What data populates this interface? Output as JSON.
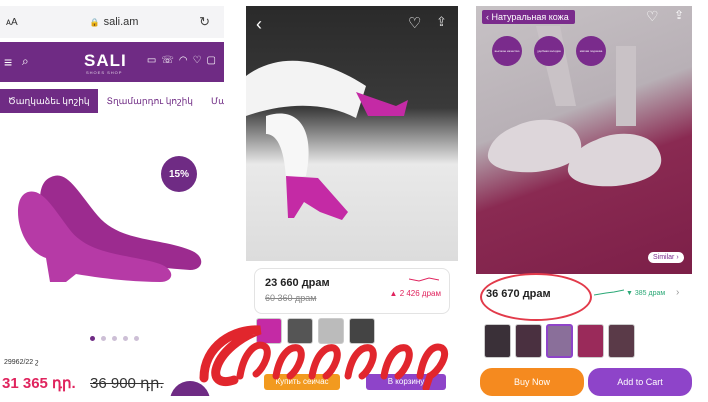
{
  "panel1": {
    "aa": "ᴀA",
    "url": "sali.am",
    "logo": "SALI",
    "logo_sub": "SHOES SHOP",
    "categories": [
      "Ծաղկաձեւ կոշիկ",
      "Տղամարդու կոշիկ",
      "Մանկակ"
    ],
    "discount": "15%",
    "sku": "29962/22 շ",
    "price_now": "31 365 դր.",
    "price_old": "36 900 դր."
  },
  "panel2": {
    "price": "23 660 драм",
    "old_price": "60 360 драм",
    "drop": "▲ 2 426 драм",
    "buttons": [
      "Купить сейчас",
      "В корзину"
    ]
  },
  "panel3": {
    "title": "Натуральная кожа",
    "features": [
      "высокое качество",
      "удобная колодка",
      "мягкая подошва"
    ],
    "similar": "Similar ›",
    "price": "36 670 драм",
    "drop": "▼ 385 драм",
    "buy_now": "Buy Now",
    "add_to_cart": "Add to Cart"
  },
  "watermark": "Ժողովուրդ",
  "colors": {
    "brand": "#6f2b84",
    "accent_pink": "#e0245e",
    "orange": "#f58a1f",
    "purple_btn": "#8e44c9",
    "watermark": "#e1262d"
  }
}
